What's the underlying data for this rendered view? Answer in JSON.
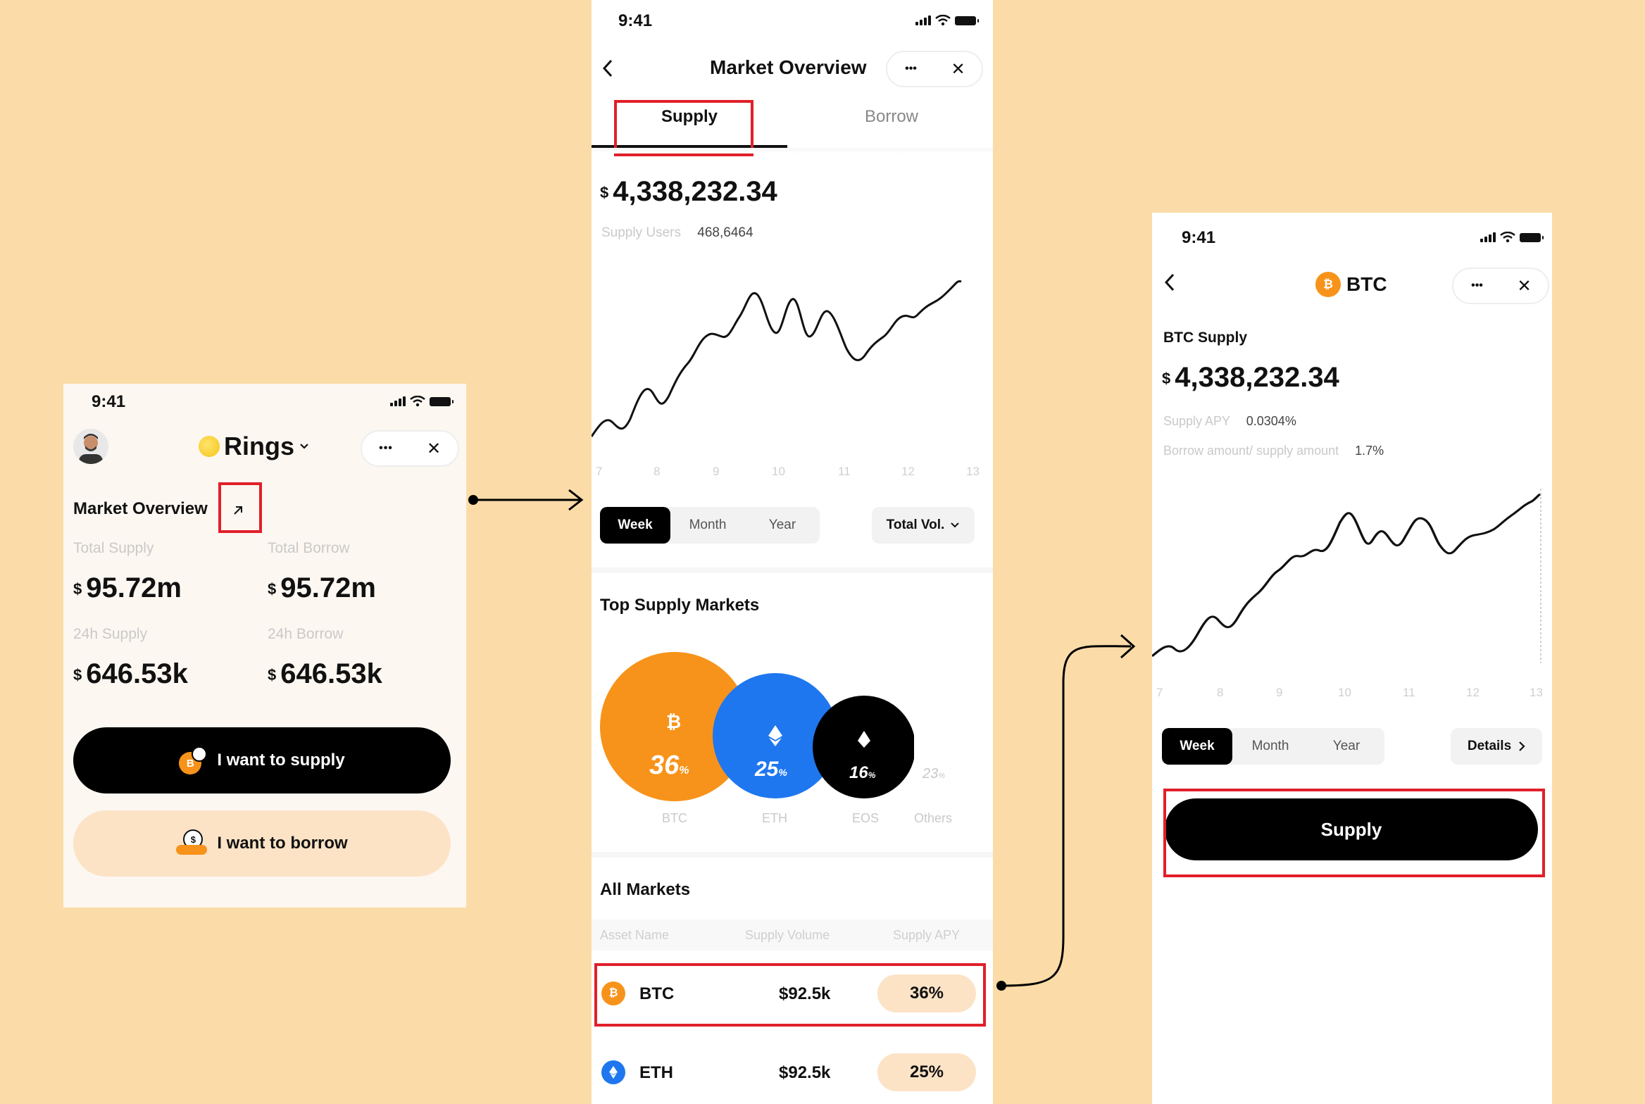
{
  "screen1": {
    "status_time": "9:41",
    "app_name": "Rings",
    "section_title": "Market Overview",
    "stats": [
      {
        "label": "Total Supply",
        "currency": "$",
        "value": "95.72m"
      },
      {
        "label": "Total Borrow",
        "currency": "$",
        "value": "95.72m"
      },
      {
        "label": "24h Supply",
        "currency": "$",
        "value": "646.53k"
      },
      {
        "label": "24h Borrow",
        "currency": "$",
        "value": "646.53k"
      }
    ],
    "supply_button": "I want to supply",
    "borrow_button": "I want to borrow",
    "more_glyph": "•••",
    "close_glyph": "✕"
  },
  "screen2": {
    "status_time": "9:41",
    "title": "Market Overview",
    "tabs": [
      "Supply",
      "Borrow"
    ],
    "total_currency": "$",
    "total_value": "4,338,232.34",
    "users_label": "Supply Users",
    "users_value": "468,6464",
    "x_ticks": [
      "7",
      "8",
      "9",
      "10",
      "11",
      "12",
      "13"
    ],
    "periods": [
      "Week",
      "Month",
      "Year"
    ],
    "selected_period": "Week",
    "metric_select": "Total Vol.",
    "top_markets_title": "Top Supply Markets",
    "top_markets": [
      {
        "name": "BTC",
        "pct": "36",
        "color": "#F7931A"
      },
      {
        "name": "ETH",
        "pct": "25",
        "color": "#1E77EE"
      },
      {
        "name": "EOS",
        "pct": "16",
        "color": "#000000"
      },
      {
        "name": "Others",
        "pct": "23"
      }
    ],
    "pct_sign": "%",
    "all_markets_title": "All Markets",
    "columns": [
      "Asset Name",
      "Supply Volume",
      "Supply APY"
    ],
    "rows": [
      {
        "asset": "BTC",
        "volume": "$92.5k",
        "apy": "36%"
      },
      {
        "asset": "ETH",
        "volume": "$92.5k",
        "apy": "25%"
      }
    ]
  },
  "screen3": {
    "status_time": "9:41",
    "title": "BTC",
    "supply_label": "BTC Supply",
    "total_currency": "$",
    "total_value": "4,338,232.34",
    "apy_label": "Supply APY",
    "apy_value": "0.0304%",
    "ratio_label": "Borrow amount/ supply amount",
    "ratio_value": "1.7%",
    "x_ticks": [
      "7",
      "8",
      "9",
      "10",
      "11",
      "12",
      "13"
    ],
    "periods": [
      "Week",
      "Month",
      "Year"
    ],
    "selected_period": "Week",
    "details_label": "Details",
    "supply_button": "Supply"
  }
}
